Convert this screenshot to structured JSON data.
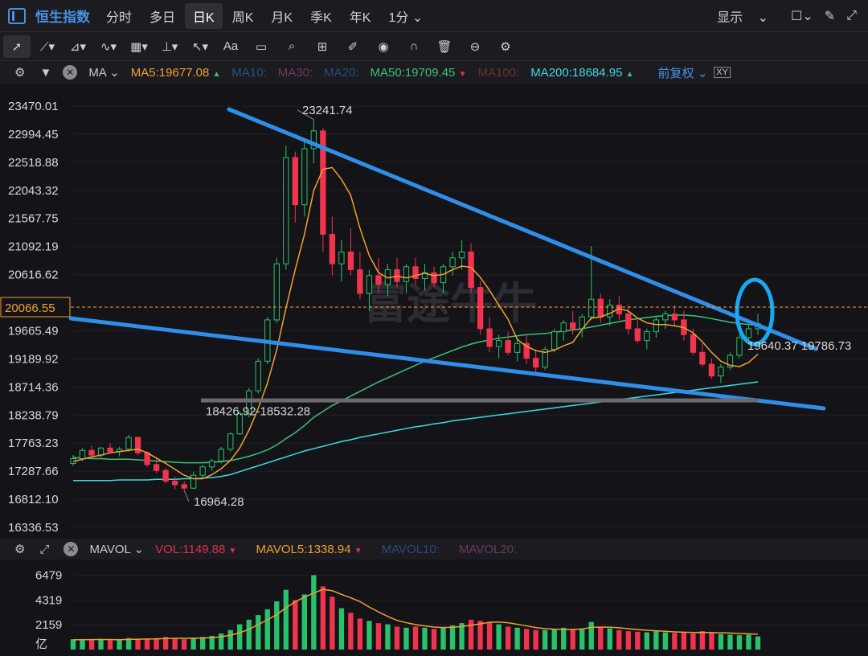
{
  "header": {
    "title": "恒生指数",
    "tabs": [
      "分时",
      "多日",
      "日K",
      "周K",
      "月K",
      "季K",
      "年K",
      "1分"
    ],
    "active_tab": "日K",
    "display_label": "显示"
  },
  "toolbar": {
    "aa_label": "Aa",
    "icons": [
      "cursor-icon",
      "line-icon",
      "path-icon",
      "wave-icon",
      "fib-icon",
      "hline-icon",
      "arrow-icon",
      "text-icon",
      "comment-icon",
      "search-icon",
      "ruler-icon",
      "pen-icon",
      "eye-icon",
      "magnet-icon",
      "trash-icon",
      "sync-icon",
      "settings-icon"
    ]
  },
  "ma_legend": {
    "ma_label": "MA",
    "ma5": "MA5:19677.08",
    "ma10": "MA10:",
    "ma30": "MA30:",
    "ma20": "MA20:",
    "ma50": "MA50:19709.45",
    "ma100": "MA100:",
    "ma200": "MA200:18684.95",
    "adjust": "前复权",
    "colors": {
      "ma5": "#f0a030",
      "ma10": "#2a5080",
      "ma30": "#6a3a60",
      "ma20": "#2a4a80",
      "ma50": "#3cc07a",
      "ma100": "#6a3030",
      "ma200": "#40d8e0",
      "adjust": "#4a90e2"
    }
  },
  "vol_legend": {
    "mavol_label": "MAVOL",
    "vol": "VOL:1149.88",
    "mavol5": "MAVOL5:1338.94",
    "mavol10": "MAVOL10:",
    "mavol20": "MAVOL20:"
  },
  "chart_data": {
    "type": "candlestick",
    "title": "恒生指数 日K",
    "y_ticks": [
      "23470.01",
      "22994.45",
      "22518.88",
      "22043.32",
      "21567.75",
      "21092.19",
      "20616.62",
      "19665.49",
      "19189.92",
      "18714.36",
      "18238.79",
      "17763.23",
      "17287.66",
      "16812.10",
      "16336.53"
    ],
    "ylim": [
      16336.53,
      23470.01
    ],
    "current_price": "20066.55",
    "annotations": {
      "high": "23241.74",
      "low": "16964.28",
      "zone": "18426.92-18532.28",
      "right_labels": "19640.37 19786.73"
    },
    "watermark": "富途牛牛",
    "ohlc": [
      [
        17420,
        17560,
        17380,
        17500
      ],
      [
        17500,
        17680,
        17460,
        17640
      ],
      [
        17640,
        17720,
        17500,
        17560
      ],
      [
        17560,
        17700,
        17520,
        17680
      ],
      [
        17680,
        17760,
        17600,
        17620
      ],
      [
        17620,
        17700,
        17540,
        17660
      ],
      [
        17660,
        17900,
        17620,
        17860
      ],
      [
        17860,
        17880,
        17560,
        17600
      ],
      [
        17600,
        17620,
        17360,
        17400
      ],
      [
        17400,
        17500,
        17250,
        17300
      ],
      [
        17300,
        17340,
        17080,
        17120
      ],
      [
        17120,
        17200,
        16980,
        17060
      ],
      [
        17060,
        17120,
        16964,
        17000
      ],
      [
        17000,
        17280,
        16990,
        17220
      ],
      [
        17220,
        17400,
        17180,
        17360
      ],
      [
        17360,
        17500,
        17300,
        17460
      ],
      [
        17460,
        17700,
        17420,
        17660
      ],
      [
        17660,
        17950,
        17620,
        17920
      ],
      [
        17920,
        18300,
        17900,
        18260
      ],
      [
        18260,
        18700,
        18200,
        18650
      ],
      [
        18650,
        19200,
        18600,
        19150
      ],
      [
        19150,
        19900,
        19100,
        19850
      ],
      [
        19850,
        20900,
        19800,
        20800
      ],
      [
        20800,
        22800,
        20700,
        22600
      ],
      [
        22600,
        22700,
        21500,
        21800
      ],
      [
        21800,
        22900,
        21600,
        22750
      ],
      [
        22750,
        23241,
        22500,
        23050
      ],
      [
        23050,
        23100,
        21000,
        21300
      ],
      [
        21300,
        21600,
        20600,
        20800
      ],
      [
        20800,
        21200,
        20500,
        21000
      ],
      [
        21000,
        21400,
        20600,
        20700
      ],
      [
        20700,
        21000,
        20200,
        20300
      ],
      [
        20300,
        20700,
        20000,
        20600
      ],
      [
        20600,
        20900,
        20300,
        20450
      ],
      [
        20450,
        20800,
        20250,
        20700
      ],
      [
        20700,
        20900,
        20400,
        20500
      ],
      [
        20500,
        20800,
        20300,
        20750
      ],
      [
        20750,
        20900,
        20450,
        20550
      ],
      [
        20550,
        20800,
        20350,
        20650
      ],
      [
        20650,
        20750,
        20400,
        20480
      ],
      [
        20480,
        20800,
        20300,
        20750
      ],
      [
        20750,
        21000,
        20600,
        20900
      ],
      [
        20900,
        21200,
        20700,
        21000
      ],
      [
        21000,
        21150,
        20300,
        20400
      ],
      [
        20400,
        20500,
        19600,
        19700
      ],
      [
        19700,
        19900,
        19300,
        19400
      ],
      [
        19400,
        19600,
        19200,
        19500
      ],
      [
        19500,
        19650,
        19250,
        19300
      ],
      [
        19300,
        19550,
        19150,
        19450
      ],
      [
        19450,
        19600,
        19100,
        19200
      ],
      [
        19200,
        19350,
        18950,
        19050
      ],
      [
        19050,
        19400,
        19000,
        19350
      ],
      [
        19350,
        19700,
        19300,
        19650
      ],
      [
        19650,
        19850,
        19500,
        19800
      ],
      [
        19800,
        20000,
        19600,
        19700
      ],
      [
        19700,
        19950,
        19550,
        19900
      ],
      [
        19900,
        21100,
        19850,
        20200
      ],
      [
        20200,
        20300,
        19800,
        19900
      ],
      [
        19900,
        20200,
        19750,
        20100
      ],
      [
        20100,
        20250,
        19850,
        19950
      ],
      [
        19950,
        20100,
        19600,
        19700
      ],
      [
        19700,
        19850,
        19450,
        19500
      ],
      [
        19500,
        19700,
        19350,
        19650
      ],
      [
        19650,
        19900,
        19550,
        19850
      ],
      [
        19850,
        20000,
        19700,
        19950
      ],
      [
        19950,
        20100,
        19750,
        19850
      ],
      [
        19850,
        20000,
        19500,
        19600
      ],
      [
        19600,
        19700,
        19250,
        19300
      ],
      [
        19300,
        19450,
        19050,
        19100
      ],
      [
        19100,
        19200,
        18850,
        18900
      ],
      [
        18900,
        19100,
        18780,
        19050
      ],
      [
        19050,
        19300,
        19000,
        19250
      ],
      [
        19250,
        19600,
        19200,
        19550
      ],
      [
        19550,
        19750,
        19450,
        19700
      ],
      [
        19700,
        19950,
        19600,
        19786
      ]
    ],
    "ma5": [
      17450,
      17490,
      17530,
      17560,
      17600,
      17620,
      17640,
      17660,
      17600,
      17510,
      17420,
      17320,
      17220,
      17160,
      17160,
      17230,
      17330,
      17470,
      17680,
      17980,
      18350,
      18780,
      19340,
      20050,
      20700,
      21300,
      22040,
      22400,
      22430,
      22230,
      21960,
      21400,
      20940,
      20650,
      20560,
      20590,
      20560,
      20600,
      20640,
      20600,
      20620,
      20700,
      20760,
      20740,
      20570,
      20350,
      20100,
      19860,
      19520,
      19400,
      19330,
      19300,
      19340,
      19410,
      19470,
      19690,
      19880,
      19900,
      19960,
      20040,
      20000,
      19880,
      19800,
      19770,
      19770,
      19750,
      19720,
      19630,
      19480,
      19300,
      19150,
      19080,
      19060,
      19130,
      19270
    ],
    "ma50": [
      17520,
      17510,
      17500,
      17500,
      17490,
      17490,
      17490,
      17480,
      17470,
      17460,
      17450,
      17440,
      17430,
      17430,
      17430,
      17440,
      17450,
      17470,
      17500,
      17540,
      17590,
      17650,
      17730,
      17840,
      17940,
      18060,
      18200,
      18300,
      18400,
      18480,
      18560,
      18640,
      18720,
      18800,
      18870,
      18940,
      19010,
      19080,
      19150,
      19210,
      19270,
      19330,
      19390,
      19440,
      19480,
      19510,
      19540,
      19560,
      19580,
      19600,
      19610,
      19620,
      19640,
      19660,
      19680,
      19700,
      19730,
      19760,
      19790,
      19820,
      19850,
      19870,
      19890,
      19910,
      19920,
      19930,
      19930,
      19920,
      19900,
      19870,
      19840,
      19810,
      19790,
      19770,
      19760
    ],
    "ma200": [
      17130,
      17130,
      17130,
      17130,
      17130,
      17140,
      17140,
      17140,
      17140,
      17150,
      17150,
      17150,
      17160,
      17160,
      17170,
      17180,
      17200,
      17230,
      17280,
      17330,
      17380,
      17430,
      17480,
      17530,
      17580,
      17630,
      17670,
      17710,
      17750,
      17790,
      17820,
      17860,
      17890,
      17920,
      17950,
      17980,
      18010,
      18040,
      18060,
      18090,
      18110,
      18140,
      18160,
      18180,
      18200,
      18220,
      18240,
      18260,
      18280,
      18300,
      18320,
      18340,
      18360,
      18380,
      18400,
      18420,
      18440,
      18460,
      18480,
      18500,
      18520,
      18540,
      18560,
      18580,
      18600,
      18620,
      18640,
      18660,
      18680,
      18700,
      18720,
      18740,
      18760,
      18780,
      18800
    ],
    "volume": {
      "y_ticks": [
        "6479",
        "4319",
        "2159",
        "亿"
      ],
      "ylim": [
        0,
        7000
      ],
      "values": [
        900,
        800,
        850,
        900,
        800,
        850,
        1000,
        900,
        950,
        1000,
        1100,
        950,
        900,
        1000,
        1100,
        1200,
        1400,
        1700,
        2200,
        2600,
        3000,
        3500,
        4200,
        5200,
        4300,
        4800,
        6479,
        5500,
        4600,
        3600,
        3200,
        2700,
        2500,
        2300,
        2200,
        2000,
        1900,
        2000,
        1900,
        1800,
        1900,
        2100,
        2300,
        2600,
        2500,
        2400,
        2200,
        2000,
        1900,
        1800,
        1700,
        1700,
        1800,
        1900,
        1800,
        1750,
        2400,
        2000,
        1850,
        1700,
        1600,
        1550,
        1500,
        1600,
        1500,
        1450,
        1500,
        1400,
        1600,
        1450,
        1350,
        1300,
        1250,
        1300,
        1149
      ],
      "mavol5": [
        850,
        860,
        870,
        880,
        870,
        860,
        880,
        900,
        920,
        930,
        960,
        980,
        980,
        990,
        1010,
        1030,
        1120,
        1240,
        1460,
        1760,
        2170,
        2590,
        3040,
        3640,
        4160,
        4560,
        4920,
        5240,
        5130,
        4800,
        4510,
        4180,
        3700,
        3280,
        2880,
        2540,
        2340,
        2180,
        2060,
        1960,
        1920,
        1940,
        2000,
        2120,
        2240,
        2380,
        2400,
        2340,
        2200,
        2060,
        1920,
        1820,
        1780,
        1760,
        1740,
        1790,
        1930,
        1950,
        1950,
        1900,
        1810,
        1740,
        1680,
        1640,
        1590,
        1540,
        1510,
        1490,
        1500,
        1480,
        1460,
        1440,
        1400,
        1370,
        1338.94
      ]
    }
  }
}
